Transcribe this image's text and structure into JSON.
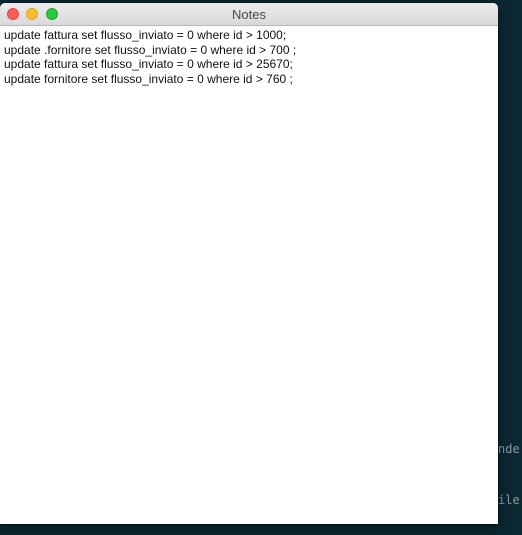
{
  "window": {
    "title": "Notes"
  },
  "note": {
    "lines": [
      "update fattura set flusso_inviato = 0 where id > 1000;",
      "update .fornitore set flusso_inviato = 0 where id > 700 ;",
      "update fattura set flusso_inviato = 0 where id > 25670;",
      "update fornitore set flusso_inviato = 0 where id > 760 ;"
    ]
  },
  "background": {
    "terminal_fragments": [
      "nde",
      "ile"
    ]
  },
  "colors": {
    "desktop_bg": "#0b2731",
    "close": "#fc5f57",
    "minimize": "#fdbc2e",
    "zoom": "#28c840"
  }
}
